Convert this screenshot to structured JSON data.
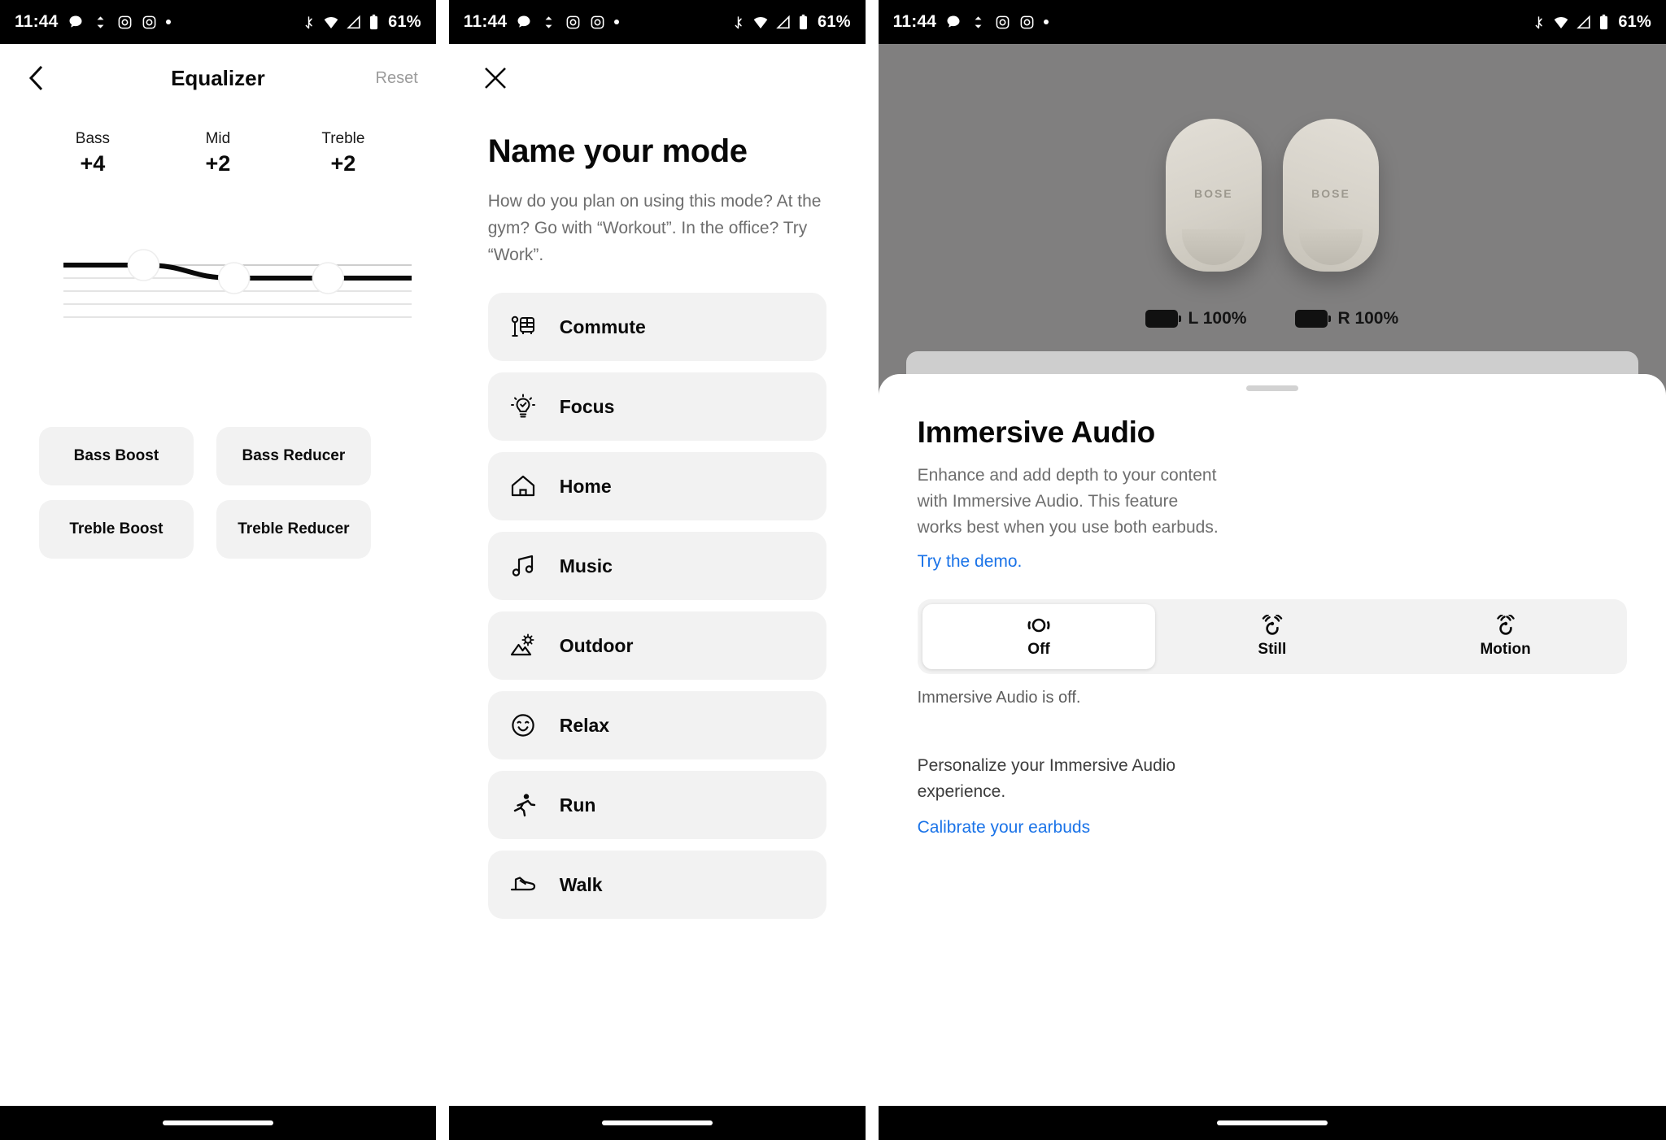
{
  "status_bar": {
    "time": "11:44",
    "left_icons": [
      "chat-bubble-icon",
      "sync-icon",
      "instagram-icon",
      "instagram-icon",
      "dot-icon"
    ],
    "right_icons": [
      "bluetooth-icon",
      "wifi-icon",
      "signal-icon",
      "battery-icon"
    ],
    "battery_percent": "61%"
  },
  "equalizer": {
    "back_icon": "chevron-left-icon",
    "title": "Equalizer",
    "reset_label": "Reset",
    "bands": [
      {
        "label": "Bass",
        "value": "+4"
      },
      {
        "label": "Mid",
        "value": "+2"
      },
      {
        "label": "Treble",
        "value": "+2"
      }
    ],
    "presets": [
      "Bass Boost",
      "Bass Reducer",
      "Treble Boost",
      "Treble Reducer"
    ]
  },
  "chart_data": {
    "type": "line",
    "title": "Equalizer curve",
    "categories": [
      "Bass",
      "Mid",
      "Treble"
    ],
    "values": [
      4,
      2,
      2
    ],
    "ylim": [
      -6,
      6
    ],
    "grid": true,
    "gridlines": [
      4,
      2,
      0,
      -2,
      -4
    ],
    "handle_positions": [
      {
        "band": "Bass",
        "x_pct": 23,
        "value": 4
      },
      {
        "band": "Mid",
        "x_pct": 49,
        "value": 2
      },
      {
        "band": "Treble",
        "x_pct": 76,
        "value": 2
      }
    ],
    "xlabel": "",
    "ylabel": "",
    "legend": []
  },
  "name_mode": {
    "close_icon": "close-icon",
    "title": "Name your mode",
    "description": "How do you plan on using this mode? At the gym? Go with “Workout”. In the office? Try “Work”.",
    "items": [
      {
        "label": "Commute",
        "icon": "bus-stop-icon"
      },
      {
        "label": "Focus",
        "icon": "lightbulb-check-icon"
      },
      {
        "label": "Home",
        "icon": "home-icon"
      },
      {
        "label": "Music",
        "icon": "music-note-icon"
      },
      {
        "label": "Outdoor",
        "icon": "mountain-sun-icon"
      },
      {
        "label": "Relax",
        "icon": "smiley-face-icon"
      },
      {
        "label": "Run",
        "icon": "running-person-icon"
      },
      {
        "label": "Walk",
        "icon": "shoe-icon"
      }
    ]
  },
  "immersive": {
    "device_battery": [
      {
        "side_icon": "battery-icon",
        "label": "L 100%"
      },
      {
        "side_icon": "battery-icon",
        "label": "R 100%"
      }
    ],
    "bud_brand": "BOSE",
    "grabber_icon": "sheet-grabber-icon",
    "title": "Immersive Audio",
    "description": "Enhance and add depth to your content with Immersive Audio. This feature works best when you use both earbuds.",
    "demo_link": "Try the demo.",
    "segments": [
      {
        "label": "Off",
        "icon": "immersive-off-icon",
        "active": true
      },
      {
        "label": "Still",
        "icon": "immersive-still-icon",
        "active": false
      },
      {
        "label": "Motion",
        "icon": "immersive-motion-icon",
        "active": false
      }
    ],
    "status_text": "Immersive Audio is off.",
    "personalize_text": "Personalize your Immersive Audio experience.",
    "calibrate_link": "Calibrate your earbuds"
  },
  "colors": {
    "link_blue": "#1a73e8",
    "chip_grey": "#f2f2f2",
    "text_primary": "#0a0a0a",
    "text_secondary": "#6e6e6e",
    "status_bar_bg": "#000000"
  }
}
